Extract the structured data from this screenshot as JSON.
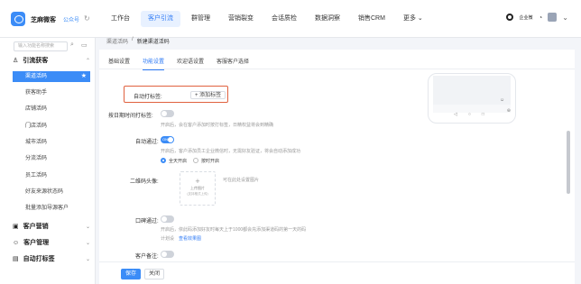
{
  "topbar": {
    "brand": "芝麻微客",
    "public_label": "公众号",
    "nav": [
      "工作台",
      "客户引流",
      "群管理",
      "营销裂变",
      "会话质检",
      "数据洞察",
      "销售CRM",
      "更多 ⌄"
    ],
    "user": "企业微"
  },
  "sidebar": {
    "search_placeholder": "输入功能名称搜索",
    "groups": [
      {
        "title": "引流获客",
        "items": [
          "渠道活码",
          "获客助手",
          "店铺活码",
          "门店活码",
          "城市活码",
          "分流活码",
          "员工活码",
          "好友来源状态码",
          "批量添加导源客户"
        ]
      },
      {
        "title": "客户营销"
      },
      {
        "title": "客户管理"
      },
      {
        "title": "自动打标签"
      }
    ]
  },
  "breadcrumb": {
    "parent": "渠道活码",
    "sep": "/",
    "current": "新建渠道活码"
  },
  "tabs": [
    "基础设置",
    "功能设置",
    "欢迎语设置",
    "客服客户选择"
  ],
  "form": {
    "auto_tag_label": "自动打标签:",
    "add_tag": "+  添加标签",
    "tag_by_time_label": "按日期时间打标签:",
    "tag_by_time_hint": "开启后，会在客户添加时按打标签，日精权益将会到精确",
    "auto_pass_label": "自动通过:",
    "auto_pass_toggle": "ON",
    "auto_pass_hint": "开启后，客户添加员工企业微信时，无需好友验证，将会自动添加成功",
    "radio_all": "全天开启",
    "radio_time": "按时开启",
    "qr_avatar_label": "二维码头像:",
    "qr_hint": "可在此处设置图片",
    "upload_label": "上传图片",
    "upload_sub": "(支持格式上传)",
    "limit_label": "口碑通过:",
    "limit_hint": "开启后，依此码添加好友时每天上于1000都会充添加渠道码的第一天的码",
    "limit_sub": "计划设",
    "limit_link": "查看效果图",
    "remark_label": "客户备注:"
  },
  "phone_preview": {
    "nav": [
      "◁",
      "○",
      "□"
    ]
  },
  "footer": {
    "save": "保存",
    "close": "关闭"
  },
  "colors": {
    "accent": "#3b8cf7",
    "highlight": "#e0613f"
  }
}
